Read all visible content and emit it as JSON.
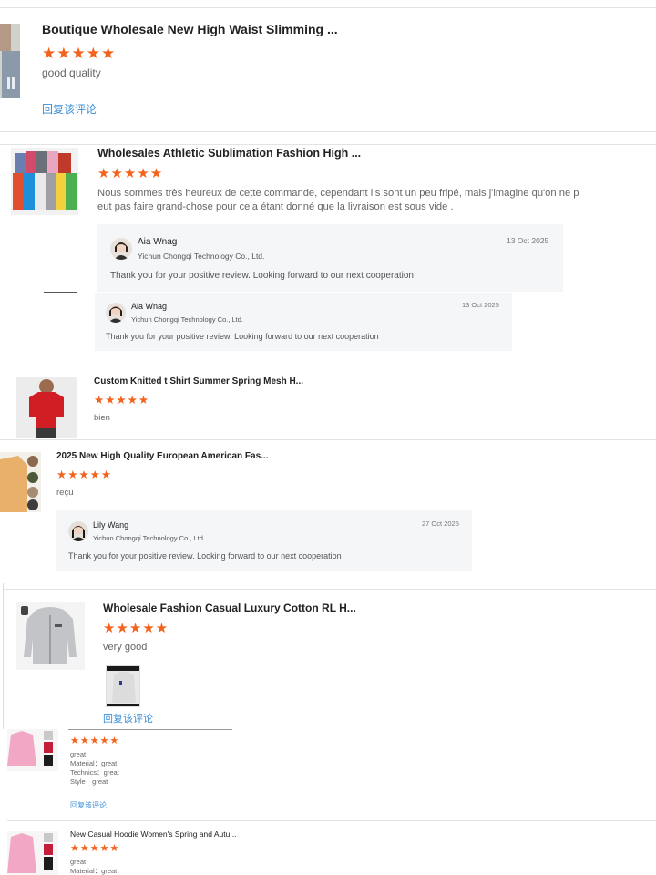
{
  "reply_link_label": "回复该评论",
  "reviews": [
    {
      "title": "Boutique Wholesale New High Waist Slimming ...",
      "stars": "★★★★★",
      "comment": "good quality",
      "reply_link": "回复该评论"
    },
    {
      "title": "Wholesales Athletic Sublimation Fashion High ...",
      "stars": "★★★★★",
      "comment_line1": "Nous sommes très heureux de cette commande, cependant ils sont un peu fripé, mais j'imagine qu'on ne p",
      "comment_line2": "eut pas faire grand-chose pour cela étant donné que la livraison est sous vide ."
    },
    {
      "title": "Custom Knitted t Shirt Summer Spring Mesh H...",
      "stars": "★★★★★",
      "comment": "bien"
    },
    {
      "title": "2025 New High Quality European American Fas...",
      "stars": "★★★★★",
      "comment": "reçu"
    },
    {
      "title": "Wholesale Fashion Casual Luxury Cotton RL H...",
      "stars": "★★★★★",
      "comment": "very good",
      "reply_link": "回复该评论"
    },
    {
      "title": "",
      "stars": "★★★★★",
      "comment_lines": [
        "great",
        "Material：great",
        "Technics：great",
        "Style：great"
      ],
      "reply_link": "回复该评论"
    },
    {
      "title": "New Casual Hoodie Women's Spring and Autu...",
      "stars": "★★★★★",
      "comment_lines": [
        "great",
        "Material：great"
      ]
    }
  ],
  "replies": [
    {
      "name": "Aia Wnag",
      "company": "Yichun Chongqi Technology Co., Ltd.",
      "date": "13 Oct 2025",
      "message": "Thank you for your positive review. Looking forward to our next cooperation"
    },
    {
      "name": "Aia Wnag",
      "company": "Yichun Chongqi Technology Co., Ltd.",
      "date": "13 Oct 2025",
      "message": "Thank you for your positive review. Looking forward to our next cooperation"
    },
    {
      "name": "Lily Wang",
      "company": "Yichun Chongqi Technology Co., Ltd.",
      "date": "27 Oct 2025",
      "message": "Thank you for your positive review. Looking forward to our next cooperation"
    }
  ],
  "colors": {
    "star": "#f2641e",
    "link": "#3a8ed8",
    "reply_bg": "#f5f6f8"
  }
}
